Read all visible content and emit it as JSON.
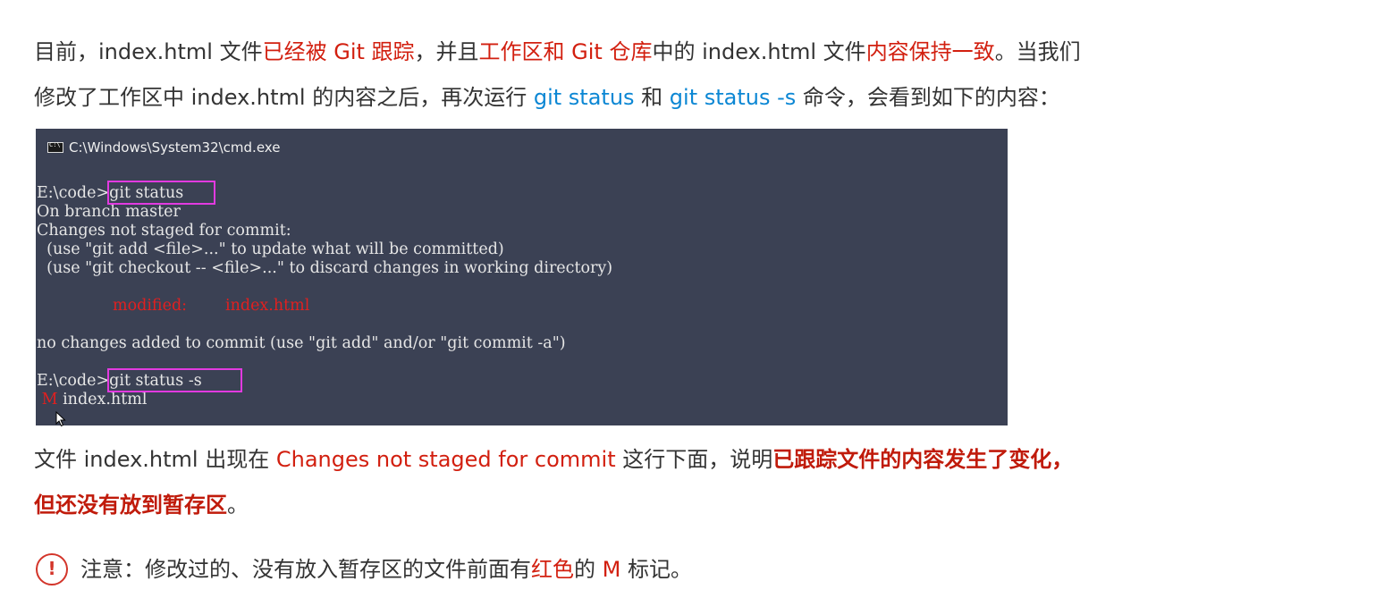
{
  "para1": {
    "line1": {
      "s1": "目前，index.html 文件",
      "s2": "已经被 Git 跟踪",
      "s3": "，并且",
      "s4": "工作区和 Git 仓库",
      "s5": "中的 index.html 文件",
      "s6": "内容保持一致",
      "s7": "。当我们"
    },
    "line2": {
      "s1": "修改了工作区中 index.html 的内容之后，再次运行 ",
      "s2": "git status",
      "s3": " 和 ",
      "s4": "git status -s",
      "s5": " 命令，会看到如下的内容："
    }
  },
  "console": {
    "title": "C:\\Windows\\System32\\cmd.exe",
    "prompt1": "E:\\code>",
    "cmd1": "git status",
    "out1": "On branch master",
    "out2": "Changes not staged for commit:",
    "out3": "  (use \"git add <file>...\" to update what will be committed)",
    "out4": "  (use \"git checkout -- <file>...\" to discard changes in working directory)",
    "modified_label": "modified:",
    "modified_file": "index.html",
    "out5": "no changes added to commit (use \"git add\" and/or \"git commit -a\")",
    "prompt2": "E:\\code>",
    "cmd2": "git status -s",
    "short_status": "M",
    "short_file": "index.html"
  },
  "para2": {
    "line1": {
      "s1": "文件 index.html 出现在 ",
      "s2": "Changes not staged for commit",
      "s3": " 这行下面，说明",
      "s4": "已跟踪文件的内容发生了变化，"
    },
    "line2": {
      "s1": "但还没有放到暂存区",
      "s2": "。"
    }
  },
  "notice": {
    "icon": "exclamation-circle-icon",
    "s1": "注意：修改过的、没有放入暂存区的文件前面有",
    "s2": "红色",
    "s3": "的 ",
    "s4": "M",
    "s5": " 标记。"
  }
}
